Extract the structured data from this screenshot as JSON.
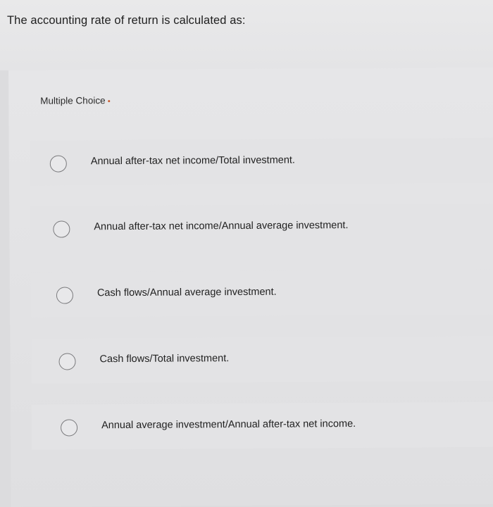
{
  "question": {
    "text": "The accounting rate of return is calculated as:"
  },
  "panel": {
    "label": "Multiple Choice"
  },
  "options": [
    {
      "label": "Annual after-tax net income/Total investment.",
      "selected": false
    },
    {
      "label": "Annual after-tax net income/Annual average investment.",
      "selected": false
    },
    {
      "label": "Cash flows/Annual average investment.",
      "selected": false
    },
    {
      "label": "Cash flows/Total investment.",
      "selected": false
    },
    {
      "label": "Annual average investment/Annual after-tax net income.",
      "selected": false
    }
  ]
}
